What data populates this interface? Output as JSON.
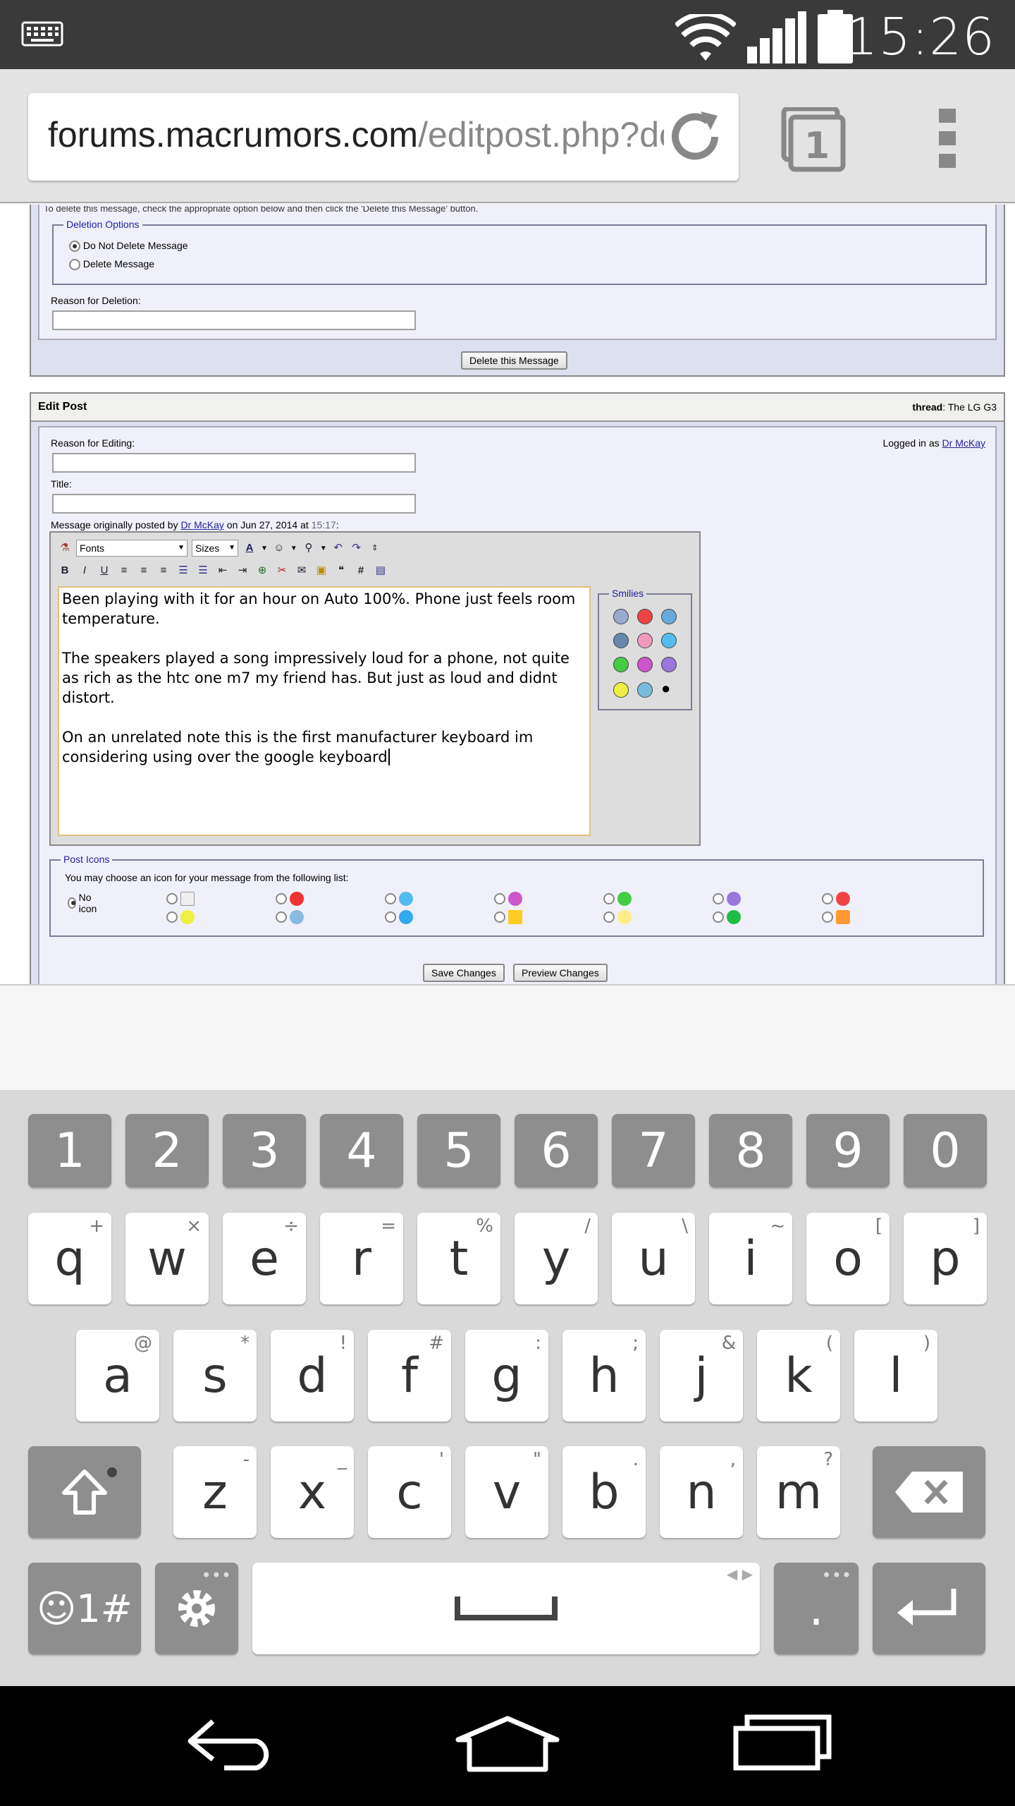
{
  "status_bar": {
    "time": "15:26",
    "icons": [
      "keyboard-icon",
      "wifi-icon",
      "signal-icon",
      "battery-icon"
    ]
  },
  "browser": {
    "url_host": "forums.macrumors.com",
    "url_path": "/editpost.php?do",
    "tab_count": "1"
  },
  "delete_section": {
    "cut_text": "To delete this message, check the appropriate option below and then click the 'Delete this Message' button.",
    "legend": "Deletion Options",
    "option_keep": "Do Not Delete Message",
    "option_delete": "Delete Message",
    "reason_label": "Reason for Deletion:",
    "delete_button": "Delete this Message"
  },
  "edit_post": {
    "header": "Edit Post",
    "thread_label": "thread",
    "thread_name": ": The LG G3",
    "reason_label": "Reason for Editing:",
    "logged_in_text": "Logged in as ",
    "logged_in_user": "Dr McKay",
    "title_label": "Title:",
    "orig_prefix": "Message originally posted by ",
    "orig_user": "Dr McKay",
    "orig_on": " on Jun 27, 2014 at ",
    "orig_time": "15:17",
    "orig_suffix": ":",
    "fonts_select": "Fonts",
    "sizes_select": "Sizes",
    "message_paragraphs": [
      "Been playing with it for an hour on Auto 100%. Phone just feels room temperature.",
      "The speakers played a song impressively loud for a phone, not quite as rich as the htc one m7 my friend has. But just as loud and didnt distort.",
      "On an unrelated note this is the first manufacturer keyboard im considering using over the google keyboard"
    ],
    "smilies_legend": "Smilies",
    "post_icons_legend": "Post Icons",
    "post_icons_text": "You may choose an icon for your message from the following list:",
    "no_icon_label": "No icon",
    "save_button": "Save Changes",
    "preview_button": "Preview Changes"
  },
  "keyboard": {
    "number_row": [
      "1",
      "2",
      "3",
      "4",
      "5",
      "6",
      "7",
      "8",
      "9",
      "0"
    ],
    "row1": [
      {
        "k": "q",
        "a": "+"
      },
      {
        "k": "w",
        "a": "×"
      },
      {
        "k": "e",
        "a": "÷"
      },
      {
        "k": "r",
        "a": "="
      },
      {
        "k": "t",
        "a": "%"
      },
      {
        "k": "y",
        "a": "/"
      },
      {
        "k": "u",
        "a": "\\"
      },
      {
        "k": "i",
        "a": "~"
      },
      {
        "k": "o",
        "a": "["
      },
      {
        "k": "p",
        "a": "]"
      }
    ],
    "row2": [
      {
        "k": "a",
        "a": "@"
      },
      {
        "k": "s",
        "a": "*"
      },
      {
        "k": "d",
        "a": "!"
      },
      {
        "k": "f",
        "a": "#"
      },
      {
        "k": "g",
        "a": ":"
      },
      {
        "k": "h",
        "a": ";"
      },
      {
        "k": "j",
        "a": "&"
      },
      {
        "k": "k",
        "a": "("
      },
      {
        "k": "l",
        "a": ")"
      }
    ],
    "row3": [
      {
        "k": "z",
        "a": "-"
      },
      {
        "k": "x",
        "a": "_"
      },
      {
        "k": "c",
        "a": "'"
      },
      {
        "k": "v",
        "a": "\""
      },
      {
        "k": "b",
        "a": "."
      },
      {
        "k": "n",
        "a": ","
      },
      {
        "k": "m",
        "a": "?"
      }
    ],
    "symbols_key": "☺1#",
    "period_key": "."
  },
  "colors": {
    "link": "#22229c",
    "panel_bg": "#dde0ee",
    "legend": "#22229c"
  }
}
